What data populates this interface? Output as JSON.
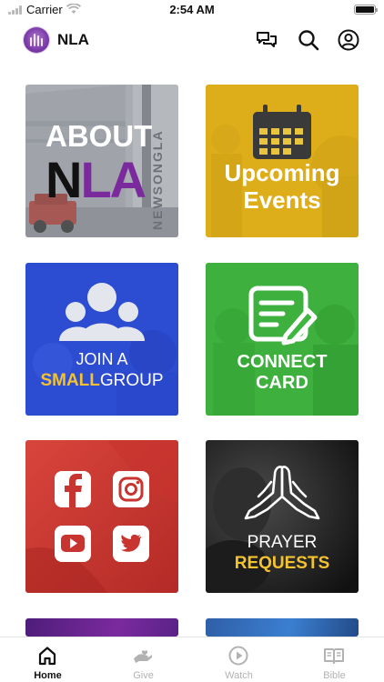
{
  "status_bar": {
    "carrier": "Carrier",
    "time": "2:54 AM"
  },
  "header": {
    "title": "NLA"
  },
  "tiles": {
    "about": {
      "line1": "ABOUT",
      "line2a": "N",
      "line2b": "LA",
      "sign": "NEWSONGLA"
    },
    "events": {
      "line1": "Upcoming",
      "line2": "Events"
    },
    "smallgroup": {
      "line1": "JOIN A",
      "line2a": "SMALL",
      "line2b": "GROUP"
    },
    "connect": {
      "line1": "CONNECT",
      "line2": "CARD"
    },
    "social": {},
    "prayer": {
      "line1": "PRAYER",
      "line2": "REQUESTS"
    }
  },
  "tab_bar": {
    "items": [
      {
        "label": "Home",
        "icon": "home-icon"
      },
      {
        "label": "Give",
        "icon": "give-icon"
      },
      {
        "label": "Watch",
        "icon": "play-icon"
      },
      {
        "label": "Bible",
        "icon": "book-icon"
      }
    ]
  },
  "colors": {
    "about_overlay": "#8e9197",
    "events_overlay": "#e2b51f",
    "smallgroup_overlay": "#2f4fd6",
    "connect_overlay": "#3fb63f",
    "social_overlay": "#c8342f",
    "prayer_overlay": "#202020",
    "accent_purple": "#7b2a9e",
    "accent_yellow": "#f2c230"
  }
}
